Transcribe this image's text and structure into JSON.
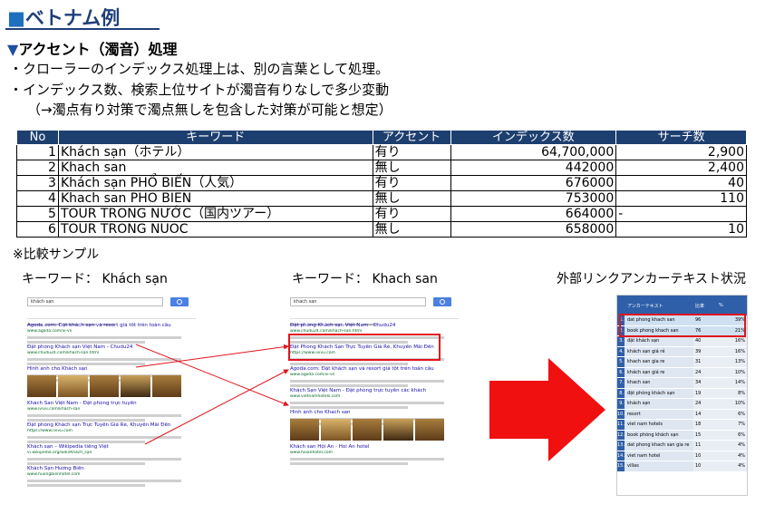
{
  "page": {
    "title_marker": "■",
    "title": "ベトナム例",
    "subhead_marker": "▼",
    "subhead": "アクセント（濁音）処理",
    "bullets": [
      "・クローラーのインデックス処理上は、別の言葉として処理。",
      "・インデックス数、検索上位サイトが濁音有りなしで多少変動",
      "（→濁点有り対策で濁点無しを包含した対策が可能と想定）"
    ]
  },
  "table": {
    "headers": [
      "No",
      "キーワード",
      "アクセント",
      "インデックス数",
      "サーチ数"
    ],
    "rows": [
      {
        "no": "1",
        "keyword": "Khách sạn（ホテル）",
        "accent": "有り",
        "index": "64,700,000",
        "search": "2,900"
      },
      {
        "no": "2",
        "keyword": "Khach san",
        "accent": "無し",
        "index": "442000",
        "search": "2,400"
      },
      {
        "no": "3",
        "keyword": "Khách sạn PHỔ BIẾN（人気）",
        "accent": "有り",
        "index": "676000",
        "search": "40"
      },
      {
        "no": "4",
        "keyword": "Khach san PHO BIEN",
        "accent": "無し",
        "index": "753000",
        "search": "110"
      },
      {
        "no": "5",
        "keyword": "TOUR TRONG NƯỚC（国内ツアー）",
        "accent": "有り",
        "index": "664000",
        "search": "-"
      },
      {
        "no": "6",
        "keyword": "TOUR TRONG NUOC",
        "accent": "無し",
        "index": "658000",
        "search": "10"
      }
    ]
  },
  "samples": {
    "note": "※比較サンプル",
    "left_caption": "キーワード： Khách sạn",
    "middle_caption": "キーワード： Khach san",
    "right_caption": "外部リンクアンカーテキスト状況"
  },
  "serp_left": {
    "query": "khách sạn",
    "results": [
      {
        "title": "Agoda.com: Đặt khách sạn và resort giá tốt trên toàn cầu",
        "url": "www.agoda.com/vi-vn"
      },
      {
        "title": "Đặt phòng Khách sạn Việt Nam - Chudu24",
        "url": "www.chudu24.com/khach-san.html"
      },
      {
        "title": "Hình ảnh cho Khách sạn",
        "url": ""
      },
      {
        "title": "Khách San Việt Nam - Đặt phòng trực tuyến",
        "url": "www.ivivu.com/khach-san"
      },
      {
        "title": "Đặt phòng Khách sạn Trực Tuyến Giá Rẻ, Khuyến Mãi Đến",
        "url": "https://www.ivivu.com"
      },
      {
        "title": "Khách sạn – Wikipedia tiếng Việt",
        "url": "vi.wikipedia.org/wiki/Khách_sạn"
      },
      {
        "title": "Khách Sạn Hương Biển",
        "url": "www.huongbienhotel.com"
      }
    ]
  },
  "serp_middle": {
    "query": "khach san",
    "results": [
      {
        "title": "Đặt phòng Khách sạn Việt Nam - Chudu24",
        "url": "www.chudu24.com/khach-san.html"
      },
      {
        "title": "Đặt Phòng Khách Sạn Trực Tuyến Giá Rẻ, Khuyến Mãi Đến",
        "url": "https://www.ivivu.com"
      },
      {
        "title": "Agoda.com: Đặt khách sạn và resort giá tốt trên toàn cầu",
        "url": "www.agoda.com/vi-vn"
      },
      {
        "title": "Khách Sạn Việt Nam - Đặt phòng trực tuyến các khách",
        "url": "www.vietnamhotels.com"
      },
      {
        "title": "Hình ảnh cho Khach san",
        "url": ""
      },
      {
        "title": "Khách san Hội An - Hoi An hotel",
        "url": "www.hoianhotel.com"
      }
    ]
  },
  "anchor_table": {
    "headers": [
      "アンカーテキスト",
      "比率",
      "%"
    ],
    "rows": [
      {
        "no": "1.",
        "text": "dat phong khach san",
        "count": "96",
        "pct": "39%"
      },
      {
        "no": "2.",
        "text": "book phong khach san",
        "count": "76",
        "pct": "21%"
      },
      {
        "no": "3.",
        "text": "đặt khách sạn",
        "count": "40",
        "pct": "16%"
      },
      {
        "no": "4.",
        "text": "khách sạn giá rẻ",
        "count": "39",
        "pct": "16%"
      },
      {
        "no": "5.",
        "text": "khach san gia re",
        "count": "31",
        "pct": "13%"
      },
      {
        "no": "6.",
        "text": "khách sạn giá re",
        "count": "24",
        "pct": "10%"
      },
      {
        "no": "7.",
        "text": "khach san",
        "count": "34",
        "pct": "14%"
      },
      {
        "no": "8.",
        "text": "đặt phòng khách sạn",
        "count": "19",
        "pct": "8%"
      },
      {
        "no": "9.",
        "text": "khách sạn",
        "count": "24",
        "pct": "10%"
      },
      {
        "no": "10.",
        "text": "resort",
        "count": "14",
        "pct": "6%"
      },
      {
        "no": "11.",
        "text": "viet nam hotels",
        "count": "18",
        "pct": "7%"
      },
      {
        "no": "12.",
        "text": "book phòng khách sạn",
        "count": "15",
        "pct": "6%"
      },
      {
        "no": "13.",
        "text": "dat phong khach san gia re",
        "count": "11",
        "pct": "4%"
      },
      {
        "no": "14.",
        "text": "viet nam hotel",
        "count": "10",
        "pct": "4%"
      },
      {
        "no": "15.",
        "text": "villas",
        "count": "10",
        "pct": "4%"
      }
    ]
  },
  "colors": {
    "title": "#1f3f7a",
    "table_header": "#1d3f6f",
    "highlight_red": "#e0141e",
    "big_arrow": "#f01010"
  }
}
